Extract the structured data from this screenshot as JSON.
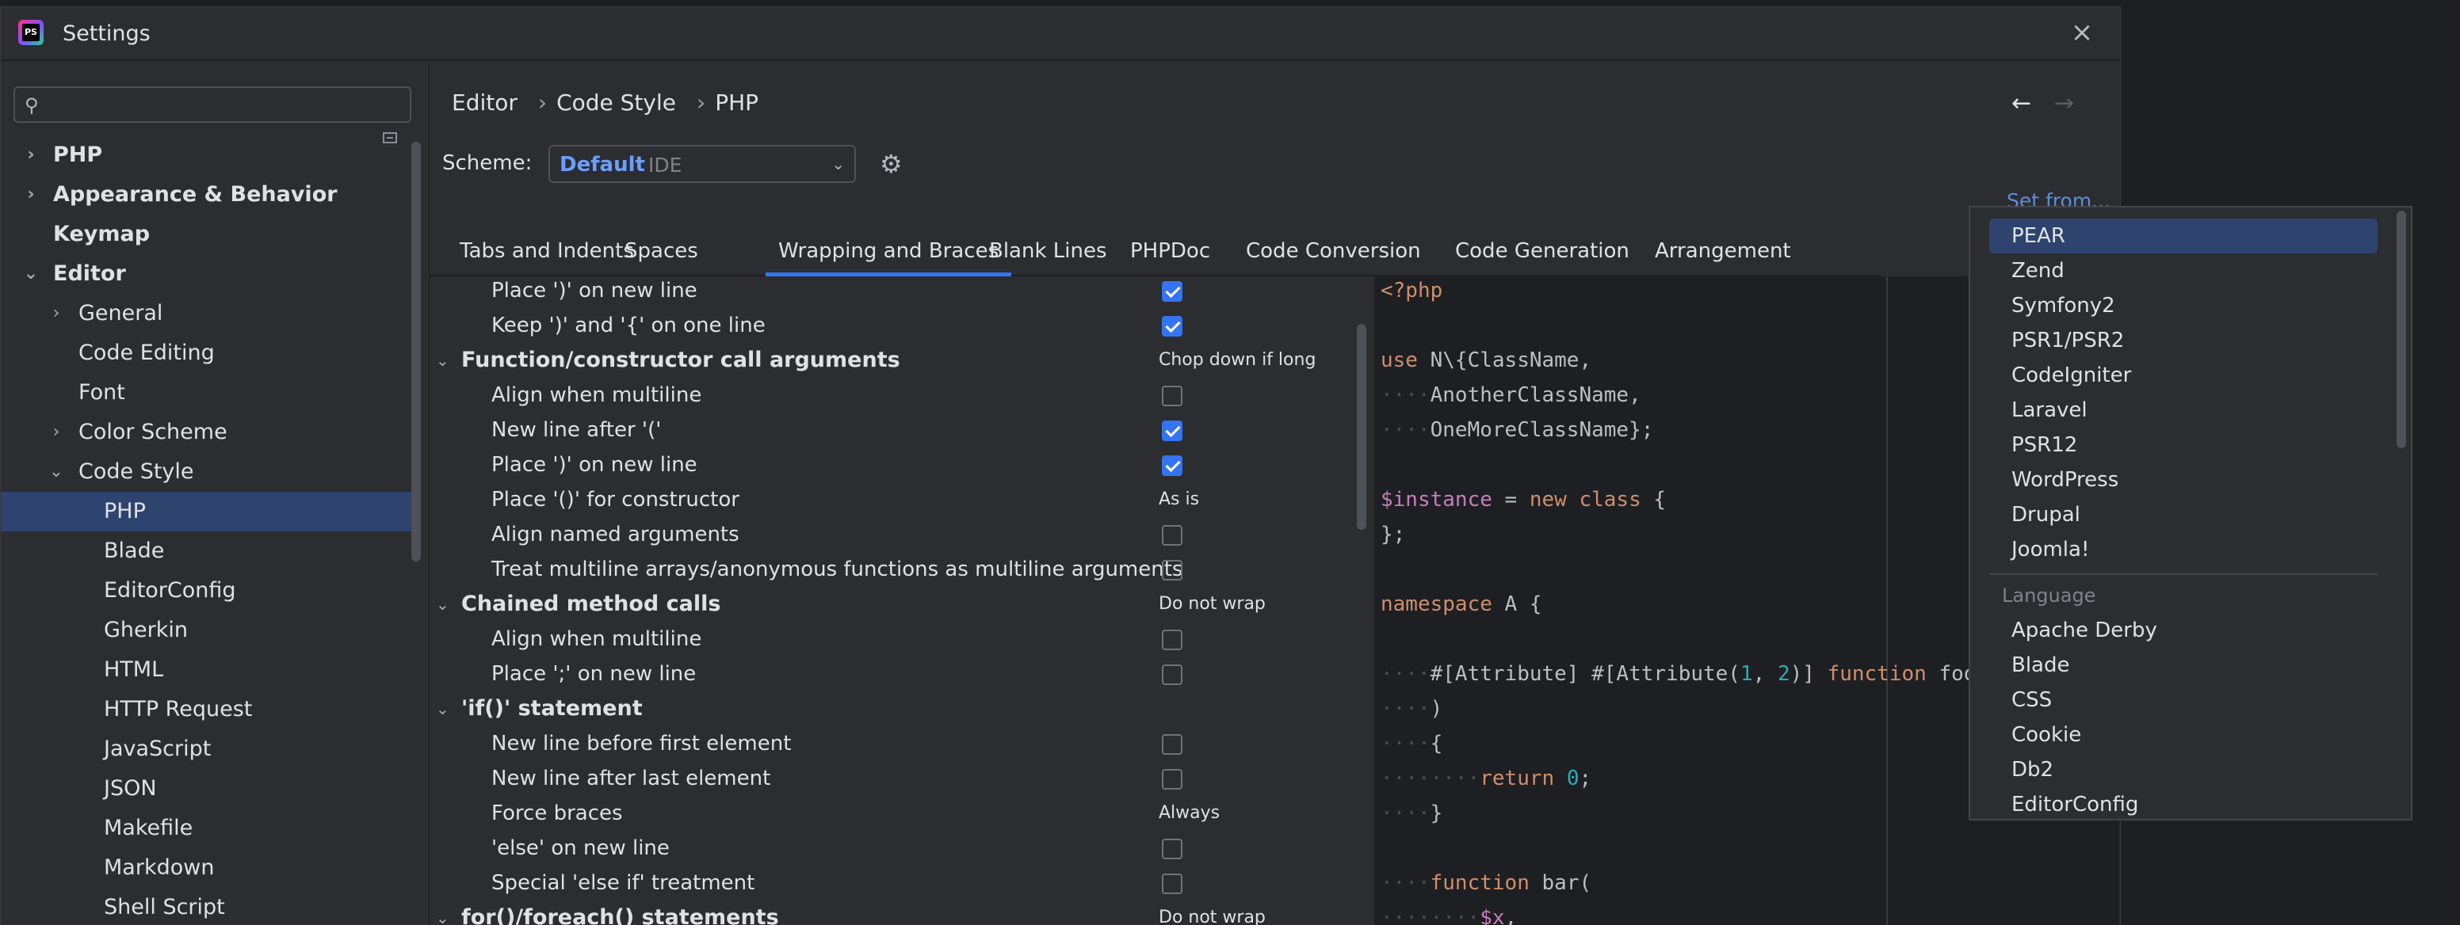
{
  "window": {
    "title": "Settings",
    "logo_text": "PS"
  },
  "search": {
    "placeholder": "",
    "value": ""
  },
  "tree": [
    {
      "label": "PHP",
      "level": 0,
      "chevron": "›",
      "bold": true
    },
    {
      "label": "Appearance & Behavior",
      "level": 0,
      "chevron": "›",
      "bold": true
    },
    {
      "label": "Keymap",
      "level": 0,
      "chevron": "",
      "bold": true
    },
    {
      "label": "Editor",
      "level": 0,
      "chevron": "⌄",
      "bold": true
    },
    {
      "label": "General",
      "level": 1,
      "chevron": "›"
    },
    {
      "label": "Code Editing",
      "level": 1,
      "chevron": ""
    },
    {
      "label": "Font",
      "level": 1,
      "chevron": ""
    },
    {
      "label": "Color Scheme",
      "level": 1,
      "chevron": "›"
    },
    {
      "label": "Code Style",
      "level": 1,
      "chevron": "⌄"
    },
    {
      "label": "PHP",
      "level": 2,
      "chevron": "",
      "selected": true
    },
    {
      "label": "Blade",
      "level": 2,
      "chevron": ""
    },
    {
      "label": "EditorConfig",
      "level": 2,
      "chevron": ""
    },
    {
      "label": "Gherkin",
      "level": 2,
      "chevron": ""
    },
    {
      "label": "HTML",
      "level": 2,
      "chevron": ""
    },
    {
      "label": "HTTP Request",
      "level": 2,
      "chevron": ""
    },
    {
      "label": "JavaScript",
      "level": 2,
      "chevron": ""
    },
    {
      "label": "JSON",
      "level": 2,
      "chevron": ""
    },
    {
      "label": "Makefile",
      "level": 2,
      "chevron": ""
    },
    {
      "label": "Markdown",
      "level": 2,
      "chevron": ""
    },
    {
      "label": "Shell Script",
      "level": 2,
      "chevron": ""
    }
  ],
  "breadcrumb": [
    "Editor",
    "Code Style",
    "PHP"
  ],
  "breadcrumb_sep": "›",
  "nav": {
    "back": "←",
    "forward": "→"
  },
  "scheme": {
    "label": "Scheme:",
    "value": "Default",
    "scope": "IDE"
  },
  "set_from": "Set from...",
  "tabs": [
    {
      "label": "Tabs and Indents"
    },
    {
      "label": "Spaces"
    },
    {
      "label": "Wrapping and Braces",
      "active": true
    },
    {
      "label": "Blank Lines"
    },
    {
      "label": "PHPDoc"
    },
    {
      "label": "Code Conversion"
    },
    {
      "label": "Code Generation"
    },
    {
      "label": "Arrangement"
    }
  ],
  "options": [
    {
      "label": "Place ')' on new line",
      "type": "check",
      "checked": true
    },
    {
      "label": "Keep ')' and '{' on one line",
      "type": "check",
      "checked": true
    },
    {
      "label": "Function/constructor call arguments",
      "type": "group",
      "value": "Chop down if long"
    },
    {
      "label": "Align when multiline",
      "type": "check",
      "checked": false
    },
    {
      "label": "New line after '('",
      "type": "check",
      "checked": true
    },
    {
      "label": "Place ')' on new line",
      "type": "check",
      "checked": true
    },
    {
      "label": "Place '()' for constructor",
      "type": "value",
      "value": "As is"
    },
    {
      "label": "Align named arguments",
      "type": "check",
      "checked": false
    },
    {
      "label": "Treat multiline arrays/anonymous functions as multiline arguments",
      "type": "check",
      "checked": false
    },
    {
      "label": "Chained method calls",
      "type": "group",
      "value": "Do not wrap"
    },
    {
      "label": "Align when multiline",
      "type": "check",
      "checked": false
    },
    {
      "label": "Place ';' on new line",
      "type": "check",
      "checked": false
    },
    {
      "label": "'if()' statement",
      "type": "group",
      "value": ""
    },
    {
      "label": "New line before first element",
      "type": "check",
      "checked": false
    },
    {
      "label": "New line after last element",
      "type": "check",
      "checked": false
    },
    {
      "label": "Force braces",
      "type": "value",
      "value": "Always"
    },
    {
      "label": "'else' on new line",
      "type": "check",
      "checked": false
    },
    {
      "label": "Special 'else if' treatment",
      "type": "check",
      "checked": false
    },
    {
      "label": "for()/foreach() statements",
      "type": "group",
      "value": "Do not wrap"
    }
  ],
  "code": [
    [
      {
        "t": "<?php",
        "c": "kw"
      }
    ],
    [],
    [
      {
        "t": "use",
        "c": "kw"
      },
      {
        "t": " N\\{ClassName,"
      }
    ],
    [
      {
        "t": "····",
        "c": "ws"
      },
      {
        "t": "AnotherClassName,"
      }
    ],
    [
      {
        "t": "····",
        "c": "ws"
      },
      {
        "t": "OneMoreClassName};"
      }
    ],
    [],
    [
      {
        "t": "$instance",
        "c": "vr"
      },
      {
        "t": " = "
      },
      {
        "t": "new class",
        "c": "kw"
      },
      {
        "t": " {"
      }
    ],
    [
      {
        "t": "};"
      }
    ],
    [],
    [
      {
        "t": "namespace",
        "c": "kw"
      },
      {
        "t": " A {"
      }
    ],
    [],
    [
      {
        "t": "····",
        "c": "ws"
      },
      {
        "t": "#[Attribute] #[Attribute("
      },
      {
        "t": "1",
        "c": "nm"
      },
      {
        "t": ", "
      },
      {
        "t": "2",
        "c": "nm"
      },
      {
        "t": ")] "
      },
      {
        "t": "function",
        "c": "kw"
      },
      {
        "t": " foo("
      }
    ],
    [
      {
        "t": "····",
        "c": "ws"
      },
      {
        "t": ")"
      }
    ],
    [
      {
        "t": "····",
        "c": "ws"
      },
      {
        "t": "{"
      }
    ],
    [
      {
        "t": "········",
        "c": "ws"
      },
      {
        "t": "return",
        "c": "kw"
      },
      {
        "t": " "
      },
      {
        "t": "0",
        "c": "nm"
      },
      {
        "t": ";"
      }
    ],
    [
      {
        "t": "····",
        "c": "ws"
      },
      {
        "t": "}"
      }
    ],
    [],
    [
      {
        "t": "····",
        "c": "ws"
      },
      {
        "t": "function",
        "c": "kw"
      },
      {
        "t": " bar("
      }
    ],
    [
      {
        "t": "········",
        "c": "ws"
      },
      {
        "t": "$x",
        "c": "vr"
      },
      {
        "t": ","
      }
    ]
  ],
  "set_from_menu": {
    "predefined": [
      "PEAR",
      "Zend",
      "Symfony2",
      "PSR1/PSR2",
      "CodeIgniter",
      "Laravel",
      "PSR12",
      "WordPress",
      "Drupal",
      "Joomla!"
    ],
    "selected": "PEAR",
    "language_header": "Language",
    "languages": [
      "Apache Derby",
      "Blade",
      "CSS",
      "Cookie",
      "Db2",
      "EditorConfig"
    ]
  },
  "colors": {
    "accent": "#3574f0",
    "selection": "#2e436e",
    "link": "#5d8edb"
  }
}
